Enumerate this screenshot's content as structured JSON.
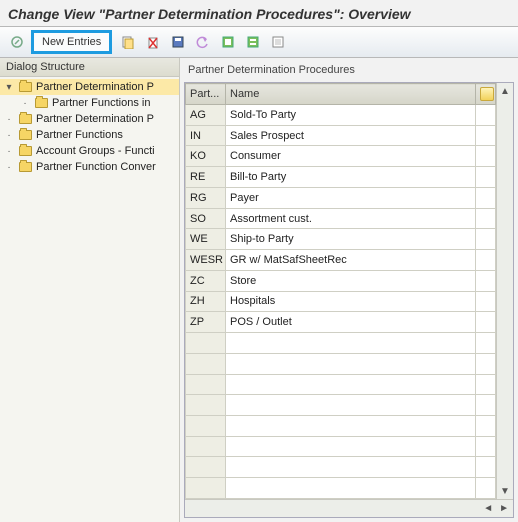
{
  "window": {
    "title": "Change View \"Partner Determination Procedures\": Overview"
  },
  "toolbar": {
    "new_entries": "New Entries"
  },
  "tree": {
    "header": "Dialog Structure",
    "nodes": [
      {
        "indent": 0,
        "toggle": "▾",
        "open": true,
        "label": "Partner Determination P",
        "selected": true
      },
      {
        "indent": 1,
        "toggle": "·",
        "open": false,
        "label": "Partner Functions in",
        "selected": false
      },
      {
        "indent": 0,
        "toggle": "·",
        "open": false,
        "label": "Partner Determination P",
        "selected": false
      },
      {
        "indent": 0,
        "toggle": "·",
        "open": false,
        "label": "Partner Functions",
        "selected": false
      },
      {
        "indent": 0,
        "toggle": "·",
        "open": false,
        "label": "Account Groups - Functi",
        "selected": false
      },
      {
        "indent": 0,
        "toggle": "·",
        "open": false,
        "label": "Partner Function Conver",
        "selected": false
      }
    ]
  },
  "table": {
    "title": "Partner Determination Procedures",
    "columns": {
      "code": "Part...",
      "name": "Name"
    },
    "rows": [
      {
        "code": "AG",
        "name": "Sold-To Party"
      },
      {
        "code": "IN",
        "name": "Sales Prospect"
      },
      {
        "code": "KO",
        "name": "Consumer"
      },
      {
        "code": "RE",
        "name": "Bill-to Party"
      },
      {
        "code": "RG",
        "name": "Payer"
      },
      {
        "code": "SO",
        "name": "Assortment cust."
      },
      {
        "code": "WE",
        "name": "Ship-to Party"
      },
      {
        "code": "WESR",
        "name": "GR w/ MatSafSheetRec"
      },
      {
        "code": "ZC",
        "name": "Store"
      },
      {
        "code": "ZH",
        "name": "Hospitals"
      },
      {
        "code": "ZP",
        "name": "POS / Outlet"
      }
    ],
    "empty_rows": 8
  }
}
